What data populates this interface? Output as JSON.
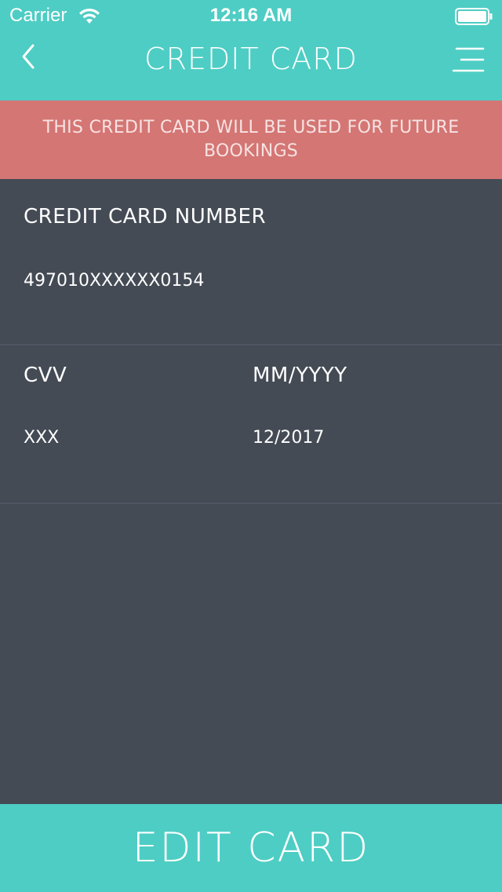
{
  "status_bar": {
    "carrier": "Carrier",
    "time": "12:16 AM",
    "wifi_icon": "wifi-icon",
    "battery_icon": "battery-icon"
  },
  "nav": {
    "title": "CREDIT CARD",
    "back_icon": "chevron-left-icon",
    "menu_icon": "hamburger-menu-icon"
  },
  "banner": {
    "text": "THIS CREDIT CARD WILL BE USED FOR FUTURE BOOKINGS"
  },
  "card": {
    "number_label": "CREDIT CARD NUMBER",
    "number_value": "497010XXXXXX0154",
    "cvv_label": "CVV",
    "cvv_value": "XXX",
    "expiry_label": "MM/YYYY",
    "expiry_value": "12/2017"
  },
  "footer": {
    "edit_label": "EDIT CARD"
  },
  "colors": {
    "accent": "#4ecdc4",
    "banner": "#d47674",
    "background": "#444b55",
    "divider": "#4f5661",
    "text": "#ffffff"
  }
}
